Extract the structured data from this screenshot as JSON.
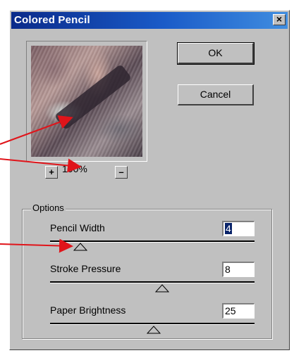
{
  "dialog": {
    "title": "Colored Pencil",
    "close_symbol": "×",
    "ok_label": "OK",
    "cancel_label": "Cancel"
  },
  "preview": {
    "zoom_in_symbol": "+",
    "zoom_out_symbol": "–",
    "zoom_level": "100%"
  },
  "options": {
    "group_label": "Options",
    "items": [
      {
        "label": "Pencil Width",
        "value": "4",
        "slider_fraction": 0.12
      },
      {
        "label": "Stroke Pressure",
        "value": "8",
        "slider_fraction": 0.53
      },
      {
        "label": "Paper Brightness",
        "value": "25",
        "slider_fraction": 0.5
      }
    ]
  },
  "colors": {
    "title_bar": "#1a5bc8",
    "dialog_bg": "#c0c0c0",
    "annotation_arrow": "#e0141a",
    "selection": "#0a246a"
  },
  "icons": {
    "close": "close-icon",
    "zoom_in": "plus-icon",
    "zoom_out": "minus-icon",
    "slider_thumb": "triangle-thumb-icon"
  }
}
